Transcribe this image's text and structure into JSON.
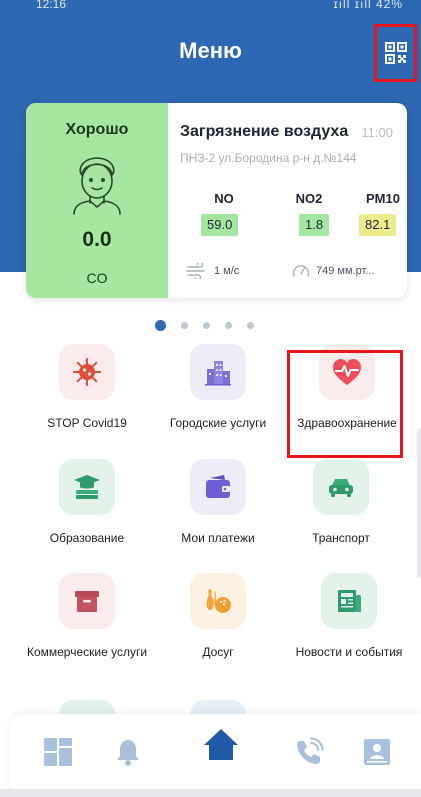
{
  "status_bar": {
    "time": "12:16",
    "system": "ɪıll ɪıll 42%"
  },
  "header": {
    "title": "Меню"
  },
  "air_card": {
    "status": "Хорошо",
    "main_value": "0.0",
    "main_gas": "CO",
    "title": "Загрязнение воздуха",
    "time": "11:00",
    "location": "ПНЗ-2 ул.Бородина р-н д.№144",
    "pollutants": [
      {
        "name": "NO",
        "value": "59.0",
        "color": "#a4e6a0"
      },
      {
        "name": "NO2",
        "value": "1.8",
        "color": "#a4e6a0"
      },
      {
        "name": "PM10",
        "value": "82.1",
        "color": "#ecec8f"
      }
    ],
    "wind": "1 м/с",
    "pressure": "749 мм.рт..."
  },
  "carousel": {
    "pages": 5,
    "active": 0
  },
  "menu": [
    {
      "label": "STOP Covid19",
      "icon": "virus-icon"
    },
    {
      "label": "Городские услуги",
      "icon": "city-buildings-icon"
    },
    {
      "label": "Здравоохранение",
      "icon": "heart-pulse-icon"
    },
    {
      "label": "Образование",
      "icon": "books-icon"
    },
    {
      "label": "Мои платежи",
      "icon": "wallet-icon"
    },
    {
      "label": "Транспорт",
      "icon": "car-icon"
    },
    {
      "label": "Коммерческие услуги",
      "icon": "archive-box-icon"
    },
    {
      "label": "Досуг",
      "icon": "bowling-icon"
    },
    {
      "label": "Новости и события",
      "icon": "newspaper-icon"
    }
  ],
  "bottom_nav": [
    {
      "icon": "dashboard-icon",
      "active": false
    },
    {
      "icon": "bell-icon",
      "active": false
    },
    {
      "icon": "home-icon",
      "active": true
    },
    {
      "icon": "phone-call-icon",
      "active": false
    },
    {
      "icon": "contact-card-icon",
      "active": false
    }
  ],
  "colors": {
    "primary": "#2d68b2",
    "good_green": "#a6e6a0",
    "highlight_red": "#e8141b"
  }
}
